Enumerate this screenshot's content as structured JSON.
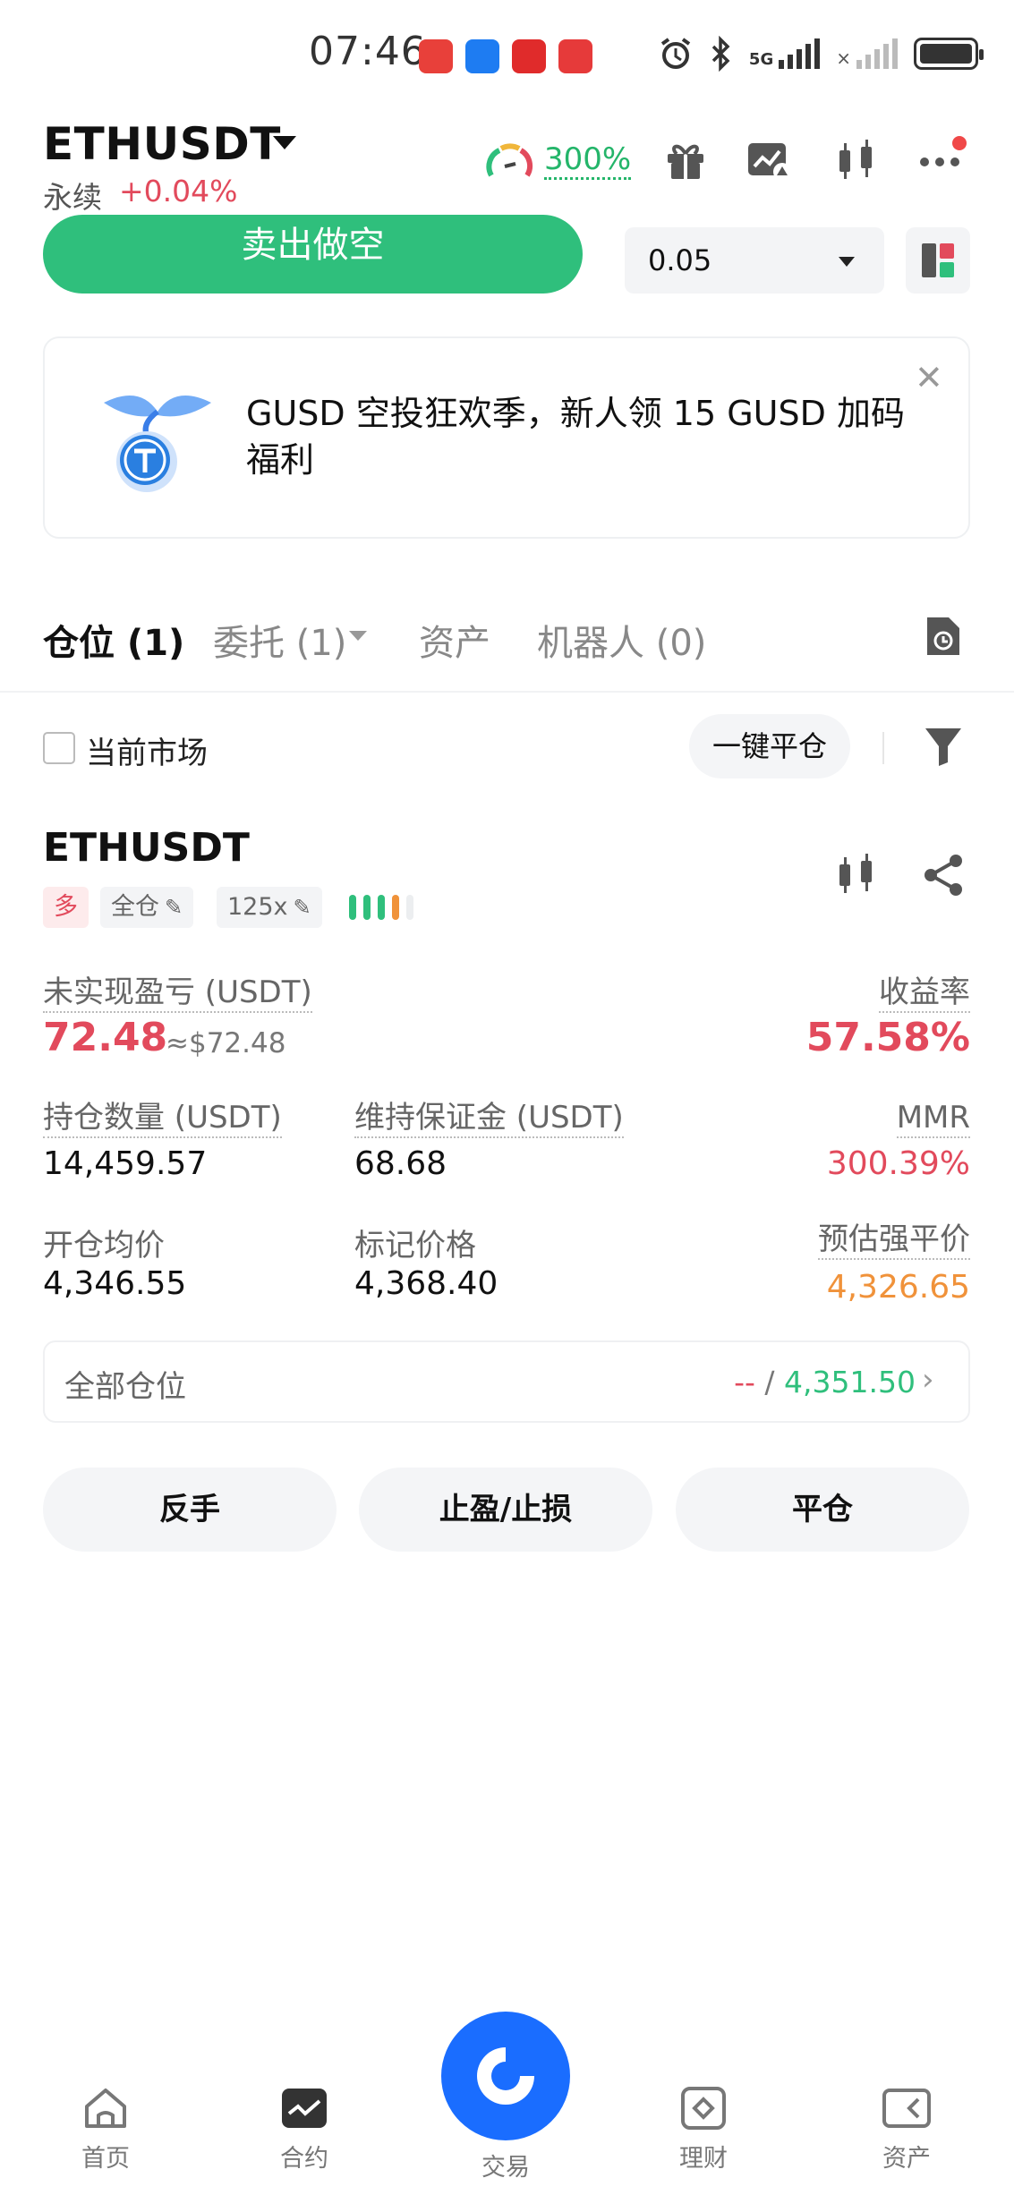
{
  "status_bar": {
    "time": "07:46",
    "network": "5G",
    "app_icons": [
      "huawei-appgallery-icon",
      "douyu-icon",
      "game-icon",
      "red-book-icon"
    ]
  },
  "header": {
    "pair": "ETHUSDT",
    "type": "永续",
    "change": "+0.04%",
    "leverage_meter": "300%"
  },
  "order": {
    "sell_label": "卖出做空",
    "amount": "0.05"
  },
  "banner": {
    "text": "GUSD 空投狂欢季，新人领 15 GUSD 加码福利"
  },
  "tabs": {
    "positions": "仓位 (1)",
    "orders": "委托 (1)",
    "assets": "资产",
    "bots": "机器人 (0)"
  },
  "filter": {
    "current_market": "当前市场",
    "close_all": "一键平仓"
  },
  "position": {
    "pair": "ETHUSDT",
    "side": "多",
    "margin_mode": "全仓",
    "leverage": "125x",
    "risk_level": 4,
    "unrealized_pnl_label": "未实现盈亏 (USDT)",
    "unrealized_pnl": "72.48",
    "unrealized_pnl_usd": "≈$72.48",
    "roe_label": "收益率",
    "roe": "57.58%",
    "size_label": "持仓数量 (USDT)",
    "size": "14,459.57",
    "maint_margin_label": "维持保证金 (USDT)",
    "maint_margin": "68.68",
    "mmr_label": "MMR",
    "mmr": "300.39%",
    "entry_label": "开仓均价",
    "entry": "4,346.55",
    "mark_label": "标记价格",
    "mark": "4,368.40",
    "liq_label": "预估强平价",
    "liq": "4,326.65"
  },
  "all_positions": {
    "label": "全部仓位",
    "left_value": "--",
    "separator": " / ",
    "right_value": "4,351.50"
  },
  "actions": {
    "reverse": "反手",
    "tp_sl": "止盈/止损",
    "close": "平仓"
  },
  "nav": {
    "home": "首页",
    "futures": "合约",
    "trade": "交易",
    "earn": "理财",
    "assets": "资产"
  },
  "colors": {
    "green": "#2fbf7c",
    "red": "#e24a5c",
    "orange": "#f0923a",
    "brand_blue": "#1a6dff"
  }
}
